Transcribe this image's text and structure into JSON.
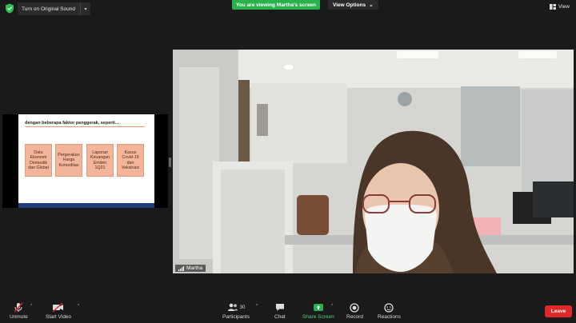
{
  "topbar": {
    "sound_button": "Turn on Original Sound",
    "viewing_banner": "You are viewing Martha's screen",
    "view_options": "View Options",
    "view": "View"
  },
  "shared_screen": {
    "title": "dengan beberapa faktor penggerak, seperti…",
    "boxes": [
      "Data Ekonomi Domestik dan Global",
      "Pergerakan Harga Komoditas",
      "Laporan Keuangan Emiten 1Q21",
      "Kasus Covid-19 dan Vaksinasi"
    ]
  },
  "video": {
    "participant_name": "Martha"
  },
  "toolbar": {
    "unmute": "Unmute",
    "start_video": "Start Video",
    "participants": "Participants",
    "participants_count": "30",
    "chat": "Chat",
    "share_screen": "Share Screen",
    "record": "Record",
    "reactions": "Reactions",
    "leave": "Leave"
  },
  "colors": {
    "accent_green": "#29b24a",
    "leave_red": "#e02828",
    "slide_box": "#f4b49a",
    "slide_footer": "#1f3f7a"
  }
}
